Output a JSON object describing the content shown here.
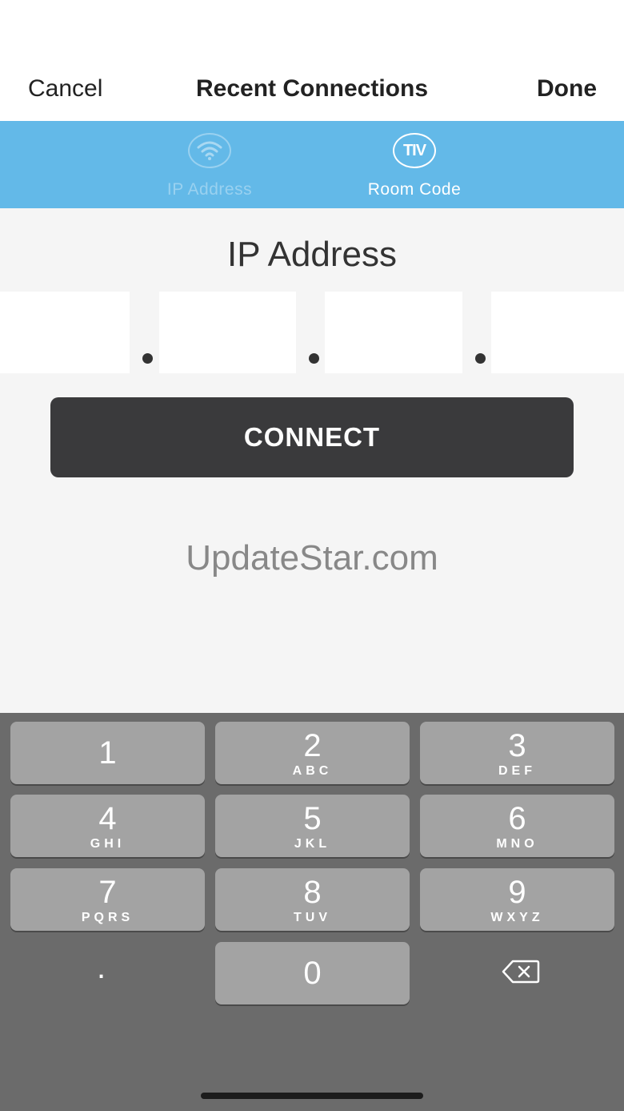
{
  "nav": {
    "cancel_label": "Cancel",
    "title": "Recent Connections",
    "done_label": "Done"
  },
  "tabs": [
    {
      "label": "IP Address",
      "icon": "wifi-icon",
      "active": false
    },
    {
      "label": "Room Code",
      "icon": "tv-icon",
      "icon_text": "TIV",
      "active": true
    }
  ],
  "heading": "IP Address",
  "ip_fields": [
    "",
    "",
    "",
    ""
  ],
  "connect_label": "CONNECT",
  "watermark": "UpdateStar.com",
  "keypad": [
    {
      "digit": "1",
      "letters": ""
    },
    {
      "digit": "2",
      "letters": "ABC"
    },
    {
      "digit": "3",
      "letters": "DEF"
    },
    {
      "digit": "4",
      "letters": "GHI"
    },
    {
      "digit": "5",
      "letters": "JKL"
    },
    {
      "digit": "6",
      "letters": "MNO"
    },
    {
      "digit": "7",
      "letters": "PQRS"
    },
    {
      "digit": "8",
      "letters": "TUV"
    },
    {
      "digit": "9",
      "letters": "WXYZ"
    },
    {
      "digit": ".",
      "letters": ""
    },
    {
      "digit": "0",
      "letters": ""
    }
  ],
  "colors": {
    "tab_bar": "#63b9e8",
    "connect_button": "#3a3a3c",
    "keyboard_bg": "#6b6b6b",
    "key_bg": "#a3a3a3"
  }
}
